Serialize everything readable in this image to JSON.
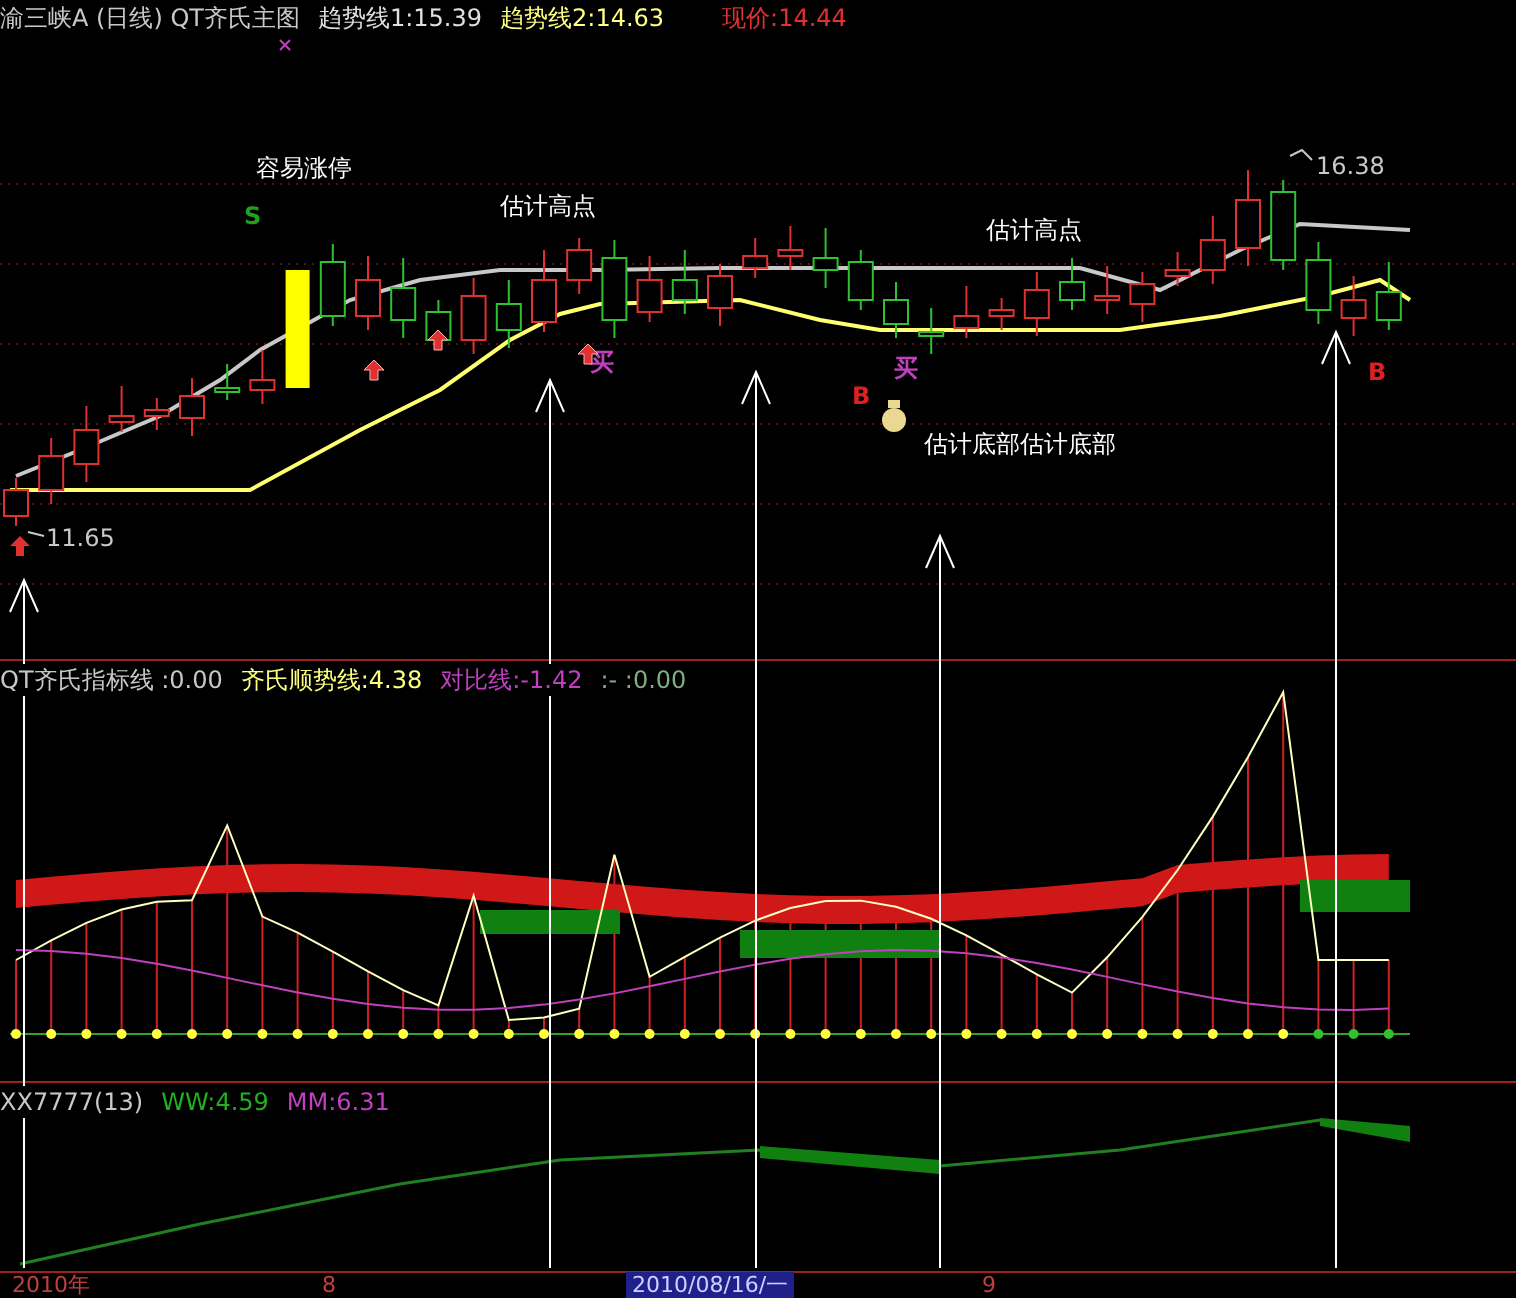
{
  "main_panel": {
    "header": [
      {
        "text": "渝三峡A (日线) QT齐氏主图",
        "color": "#c8c8c8"
      },
      {
        "text": "趋势线1:15.39",
        "color": "#e0e0e0"
      },
      {
        "text": "趋势线2:14.63",
        "color": "#ffff80"
      },
      {
        "text": "现价:14.44",
        "color": "#e03030"
      }
    ],
    "annotations": [
      "容易涨停",
      "估计高点",
      "估计高点",
      "估计底部估计底部"
    ],
    "signals": [
      {
        "text": "S",
        "color": "#20a020"
      },
      {
        "text": "买",
        "color": "#c040c0"
      },
      {
        "text": "买",
        "color": "#c040c0"
      },
      {
        "text": "B",
        "color": "#e02020"
      },
      {
        "text": "B",
        "color": "#e02020"
      }
    ],
    "high_label": "16.38",
    "low_label": "11.65"
  },
  "indicator_panel": {
    "header": [
      {
        "text": "QT齐氏指标线 :0.00",
        "color": "#c8c8c8"
      },
      {
        "text": "齐氏顺势线:4.38",
        "color": "#ffff80"
      },
      {
        "text": "对比线:-1.42",
        "color": "#c040c0"
      },
      {
        "text": ":- :0.00",
        "color": "#80b080"
      }
    ]
  },
  "volume_panel": {
    "header": [
      {
        "text": "XX7777(13)",
        "color": "#c8c8c8"
      },
      {
        "text": "WW:4.59",
        "color": "#20b020"
      },
      {
        "text": "MM:6.31",
        "color": "#c040c0"
      }
    ]
  },
  "time_axis": [
    {
      "text": "2010年",
      "selected": false
    },
    {
      "text": "8",
      "selected": false
    },
    {
      "text": "2010/08/16/一",
      "selected": true
    },
    {
      "text": "9",
      "selected": false
    }
  ]
}
